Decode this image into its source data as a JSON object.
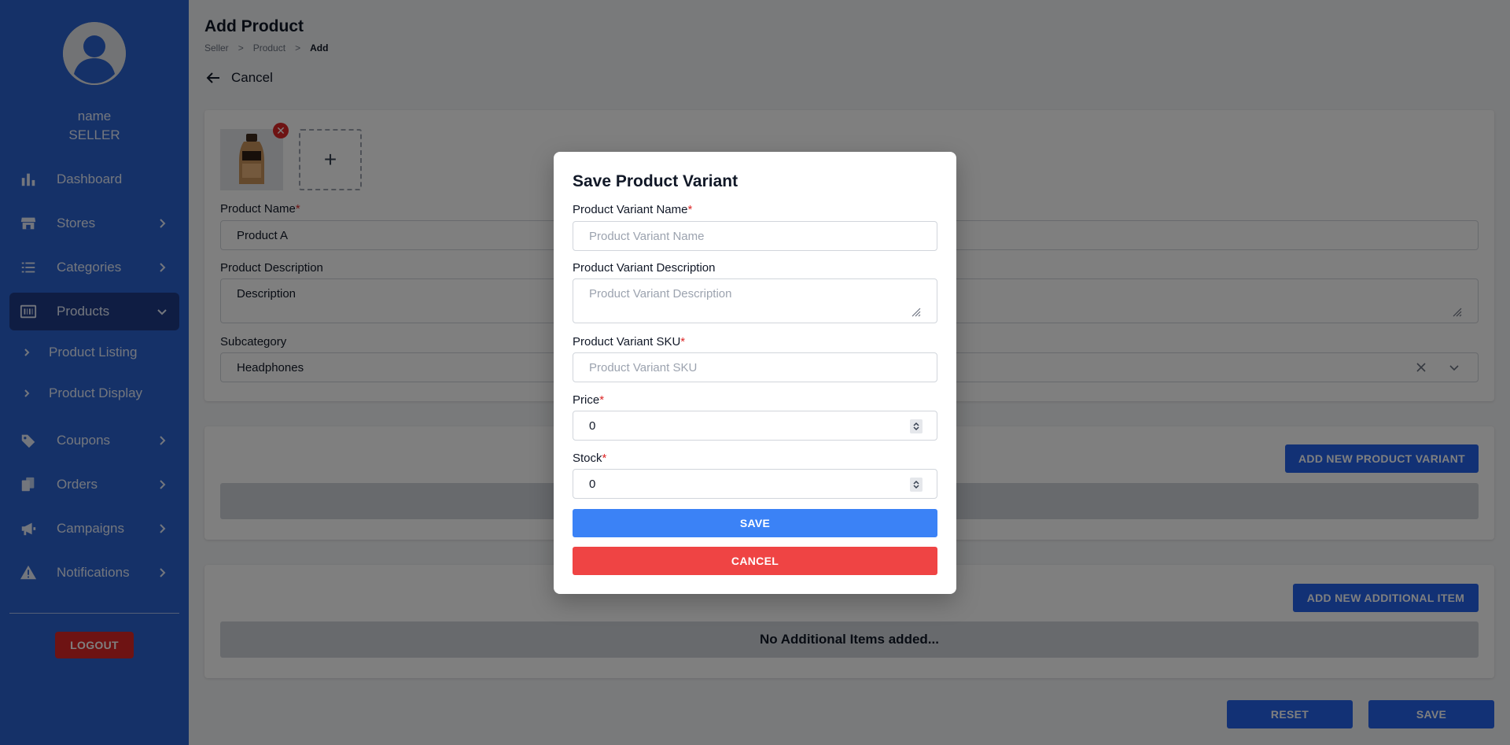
{
  "sidebar": {
    "user_name": "name",
    "user_role": "SELLER",
    "items": [
      {
        "label": "Dashboard",
        "icon": "bar-chart-icon"
      },
      {
        "label": "Stores",
        "icon": "store-icon"
      },
      {
        "label": "Categories",
        "icon": "list-icon"
      },
      {
        "label": "Products",
        "icon": "barcode-icon"
      },
      {
        "label": "Coupons",
        "icon": "tag-icon"
      },
      {
        "label": "Orders",
        "icon": "documents-icon"
      },
      {
        "label": "Campaigns",
        "icon": "megaphone-icon"
      },
      {
        "label": "Notifications",
        "icon": "warning-icon"
      }
    ],
    "sub_items": [
      "Product Listing",
      "Product Display"
    ],
    "logout_label": "LOGOUT"
  },
  "header": {
    "title": "Add Product",
    "breadcrumb": [
      "Seller",
      ">",
      "Product",
      ">",
      "Add"
    ],
    "back_label": "Cancel"
  },
  "form": {
    "product_name_label": "Product Name",
    "product_name_value": "Product A",
    "description_label": "Product Description",
    "description_value": "Description",
    "subcategory_label": "Subcategory",
    "subcategory_value": "Headphones",
    "add_variant_label": "ADD NEW PRODUCT VARIANT",
    "add_item_label": "ADD NEW ADDITIONAL ITEM",
    "no_items_text": "No Additional Items added...",
    "reset_label": "RESET",
    "save_label": "SAVE",
    "required_mark": "*",
    "add_image_glyph": "+"
  },
  "modal": {
    "title": "Save Product Variant",
    "name_label": "Product Variant Name",
    "name_placeholder": "Product Variant Name",
    "description_label": "Product Variant Description",
    "description_placeholder": "Product Variant Description",
    "sku_label": "Product Variant SKU",
    "sku_placeholder": "Product Variant SKU",
    "price_label": "Price",
    "price_value": "0",
    "stock_label": "Stock",
    "stock_value": "0",
    "save_label": "SAVE",
    "cancel_label": "CANCEL"
  },
  "colors": {
    "sidebar": "#2b63d1",
    "sidebar_active": "#1f3b86",
    "primary": "#2563eb",
    "modal_save": "#3b82f6",
    "danger": "#ef4444"
  }
}
